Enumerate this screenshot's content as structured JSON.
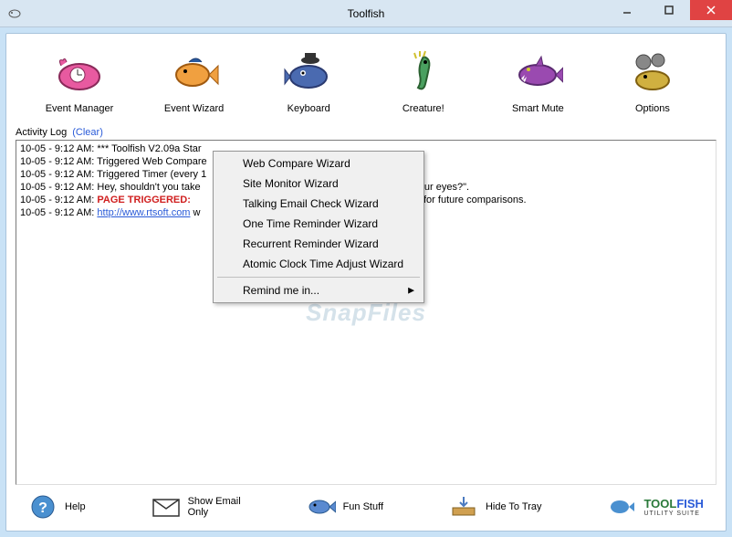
{
  "window": {
    "title": "Toolfish"
  },
  "toolbar": [
    {
      "label": "Event Manager",
      "icon": "whale",
      "color": "#e85aa0"
    },
    {
      "label": "Event Wizard",
      "icon": "fish",
      "color": "#f08a2a"
    },
    {
      "label": "Keyboard",
      "icon": "shark-hat",
      "color": "#3a5aa0"
    },
    {
      "label": "Creature!",
      "icon": "seahorse",
      "color": "#3aa060"
    },
    {
      "label": "Smart Mute",
      "icon": "shark",
      "color": "#8a3aa0"
    },
    {
      "label": "Options",
      "icon": "gearfish",
      "color": "#c8a030"
    }
  ],
  "log": {
    "header": "Activity Log",
    "clear": "(Clear)",
    "lines": [
      {
        "ts": "10-05 - 9:12 AM:",
        "text": " *** Toolfish V2.09a Star"
      },
      {
        "ts": "10-05 - 9:12 AM:",
        "text": " Triggered Web Compare"
      },
      {
        "ts": "10-05 - 9:12 AM:",
        "text": " Triggered Timer (every 1"
      },
      {
        "ts": "10-05 - 9:12 AM:",
        "text": " Hey, shouldn't you take",
        "tail": "est your eyes?\"."
      },
      {
        "ts": "10-05 - 9:12 AM:",
        "trig": " PAGE TRIGGERED:",
        "tail": "in page for future comparisons."
      },
      {
        "ts": "10-05 - 9:12 AM:",
        "link": "http://www.rtsoft.com",
        "text2": " w"
      }
    ]
  },
  "menu": [
    "Web Compare Wizard",
    "Site Monitor Wizard",
    "Talking Email Check Wizard",
    "One Time Reminder Wizard",
    "Recurrent Reminder Wizard",
    "Atomic Clock Time Adjust Wizard"
  ],
  "menu_sub": "Remind me in...",
  "bottom": {
    "help": "Help",
    "email": "Show Email\nOnly",
    "fun": "Fun Stuff",
    "tray": "Hide To Tray",
    "logo1": "TOOL",
    "logo2": "FISH",
    "logo_sub": "UTILITY SUITE"
  },
  "watermark": "SnapFiles"
}
